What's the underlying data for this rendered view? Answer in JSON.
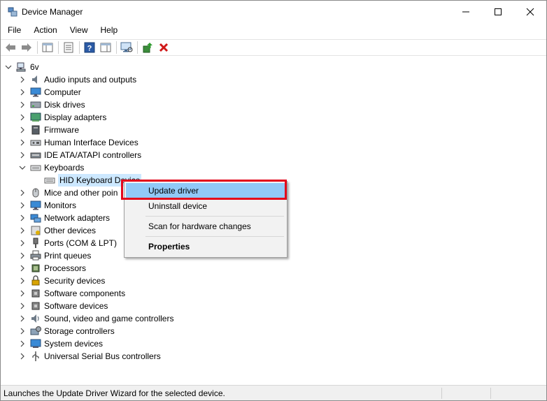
{
  "window": {
    "title": "Device Manager"
  },
  "menubar": {
    "items": [
      "File",
      "Action",
      "View",
      "Help"
    ]
  },
  "toolbar": {
    "buttons": [
      "back-icon",
      "forward-icon",
      "show-hide-console-tree-icon",
      "properties-icon",
      "help-icon",
      "action-pane-icon",
      "scan-hardware-icon",
      "update-driver-icon",
      "uninstall-icon"
    ]
  },
  "tree": {
    "root": "6v",
    "categories": [
      {
        "label": "Audio inputs and outputs"
      },
      {
        "label": "Computer"
      },
      {
        "label": "Disk drives"
      },
      {
        "label": "Display adapters"
      },
      {
        "label": "Firmware"
      },
      {
        "label": "Human Interface Devices"
      },
      {
        "label": "IDE ATA/ATAPI controllers"
      },
      {
        "label": "Keyboards"
      },
      {
        "label": "Mice and other poin"
      },
      {
        "label": "Monitors"
      },
      {
        "label": "Network adapters"
      },
      {
        "label": "Other devices"
      },
      {
        "label": "Ports (COM & LPT)"
      },
      {
        "label": "Print queues"
      },
      {
        "label": "Processors"
      },
      {
        "label": "Security devices"
      },
      {
        "label": "Software components"
      },
      {
        "label": "Software devices"
      },
      {
        "label": "Sound, video and game controllers"
      },
      {
        "label": "Storage controllers"
      },
      {
        "label": "System devices"
      },
      {
        "label": "Universal Serial Bus controllers"
      }
    ],
    "keyboard_child": "HID Keyboard Device"
  },
  "context_menu": {
    "update_driver": "Update driver",
    "uninstall_device": "Uninstall device",
    "scan_hardware": "Scan for hardware changes",
    "properties": "Properties"
  },
  "statusbar": {
    "text": "Launches the Update Driver Wizard for the selected device."
  },
  "colors": {
    "highlight": "#91c9f7",
    "selection": "#cce8ff",
    "annotation_box": "#e3061b"
  }
}
